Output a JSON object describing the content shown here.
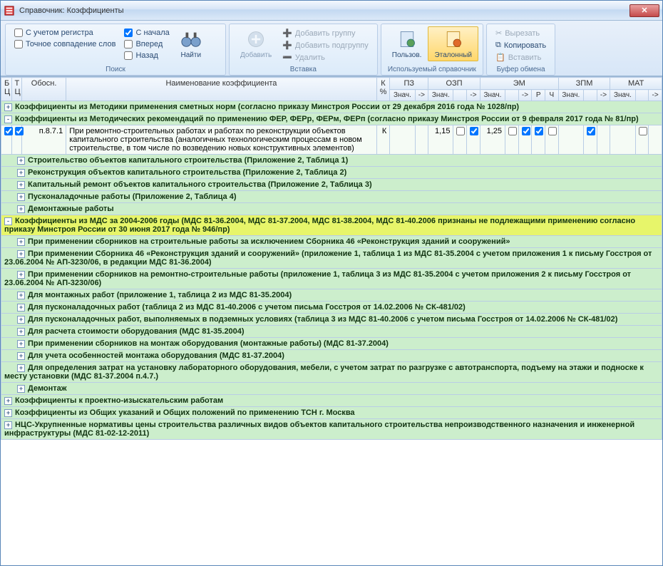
{
  "window": {
    "title": "Справочник: Коэффициенты"
  },
  "ribbon": {
    "search": {
      "label": "Поиск",
      "s_nachala": "С начала",
      "s_uchetom": "С учетом регистра",
      "tochnoe": "Точное совпадение слов",
      "vpered": "Вперед",
      "nazad": "Назад",
      "naiti": "Найти"
    },
    "vstavka": {
      "label": "Вставка",
      "dobavit": "Добавить",
      "dob_gruppu": "Добавить группу",
      "dob_podgruppu": "Добавить подгруппу",
      "udalit": "Удалить"
    },
    "sprav": {
      "label": "Используемый справочник",
      "polzov": "Пользов.",
      "etalon": "Эталонный"
    },
    "bufer": {
      "label": "Буфер обмена",
      "vyrezat": "Вырезать",
      "kopirovat": "Копировать",
      "vstavit": "Вставить"
    }
  },
  "columns": {
    "b_c": "Б Ц",
    "t_c": "Т Ц",
    "obosn": "Обосн.",
    "naim": "Наименование коэффициента",
    "k_pct": "К %",
    "pz": "ПЗ",
    "ozp": "ОЗП",
    "em": "ЭМ",
    "zpm": "ЗПМ",
    "mat": "МАТ",
    "znach": "Знач.",
    "arrow": "->",
    "r": "Р",
    "ch": "Ч"
  },
  "row": {
    "obosn": "п.8.7.1",
    "naim": "При ремонтно-строительных работах и работах по реконструкции объектов капитального строительства (аналогичных технологическим процессам в новом строительстве, в том числе по возведению новых конструктивных элементов)",
    "k": "К",
    "ozp_val": "1,15",
    "em_val": "1,25"
  },
  "groups": [
    {
      "exp": "+",
      "text": "Коэффициенты из Методики применения сметных норм (согласно приказу Минстроя России от 29 декабря 2016 года № 1028/пр)"
    },
    {
      "exp": "-",
      "text": "Коэффициенты из Методических рекомендаций по применению ФЕР, ФЕРр, ФЕРм, ФЕРп (согласно приказу Минстроя России от 9 февраля 2017 года № 81/пр)"
    },
    {
      "exp": "+",
      "text": "Строительство объектов капитального строительства (Приложение 2, Таблица 1)",
      "sub": true
    },
    {
      "exp": "+",
      "text": "Реконструкция объектов капитального строительства (Приложение 2, Таблица 2)",
      "sub": true
    },
    {
      "exp": "+",
      "text": "Капитальный ремонт объектов капитального строительства (Приложение 2, Таблица 3)",
      "sub": true
    },
    {
      "exp": "+",
      "text": "Пусконаладочные работы (Приложение 2, Таблица 4)",
      "sub": true
    },
    {
      "exp": "+",
      "text": "Демонтажные работы",
      "sub": true
    },
    {
      "exp": "-",
      "text": "Коэффициенты из МДС за 2004-2006 годы (МДС 81-36.2004, МДС 81-37.2004, МДС 81-38.2004, МДС 81-40.2006 признаны не подлежащими применению согласно приказу Минстроя России от 30 июня 2017 года № 946/пр)",
      "hl": true
    },
    {
      "exp": "+",
      "text": "При применении сборников на строительные работы за исключением Сборника 46 «Реконструкция зданий и сооружений»",
      "sub": true
    },
    {
      "exp": "+",
      "text": "При применении Сборника 46 «Реконструкция зданий и сооружений» (приложение 1, таблица 1 из МДС 81-35.2004 с учетом приложения 1 к письму Госстроя от 23.06.2004 № АП-3230/06, в редакции МДС 81-36.2004)",
      "sub": true
    },
    {
      "exp": "+",
      "text": "При применении сборников на ремонтно-строительные работы (приложение 1, таблица 3 из МДС 81-35.2004 с учетом приложения 2 к письму Госстроя от 23.06.2004 № АП-3230/06)",
      "sub": true
    },
    {
      "exp": "+",
      "text": "Для монтажных работ (приложение 1, таблица 2 из МДС 81-35.2004)",
      "sub": true
    },
    {
      "exp": "+",
      "text": "Для пусконаладочных работ (таблица 2 из МДС 81-40.2006 с учетом письма Госстроя от 14.02.2006 № СК-481/02)",
      "sub": true
    },
    {
      "exp": "+",
      "text": "Для пусконаладочных работ, выполняемых в подземных условиях (таблица 3 из МДС 81-40.2006 с учетом письма Госстроя от 14.02.2006 № СК-481/02)",
      "sub": true
    },
    {
      "exp": "+",
      "text": "Для расчета стоимости оборудования (МДС 81-35.2004)",
      "sub": true
    },
    {
      "exp": "+",
      "text": "При применении сборников на монтаж оборудования (монтажные работы) (МДС 81-37.2004)",
      "sub": true
    },
    {
      "exp": "+",
      "text": "Для учета особенностей монтажа оборудования (МДС 81-37.2004)",
      "sub": true
    },
    {
      "exp": "+",
      "text": "Для определения затрат на установку лабораторного оборудования, мебели, с учетом затрат по разгрузке с автотранспорта, подъему на этажи и подноске к месту установки (МДС 81-37.2004 п.4.7.)",
      "sub": true
    },
    {
      "exp": "+",
      "text": "Демонтаж",
      "sub": true
    },
    {
      "exp": "+",
      "text": "Коэффициенты к проектно-изыскательским работам"
    },
    {
      "exp": "+",
      "text": "Коэффициенты из Общих указаний и Общих положений по применению ТСН г. Москва"
    },
    {
      "exp": "+",
      "text": "НЦС-Укрупненные нормативы цены строительства различных видов объектов капитального строительства непроизводственного назначения и инженерной инфраструктуры (МДС 81-02-12-2011)"
    }
  ]
}
